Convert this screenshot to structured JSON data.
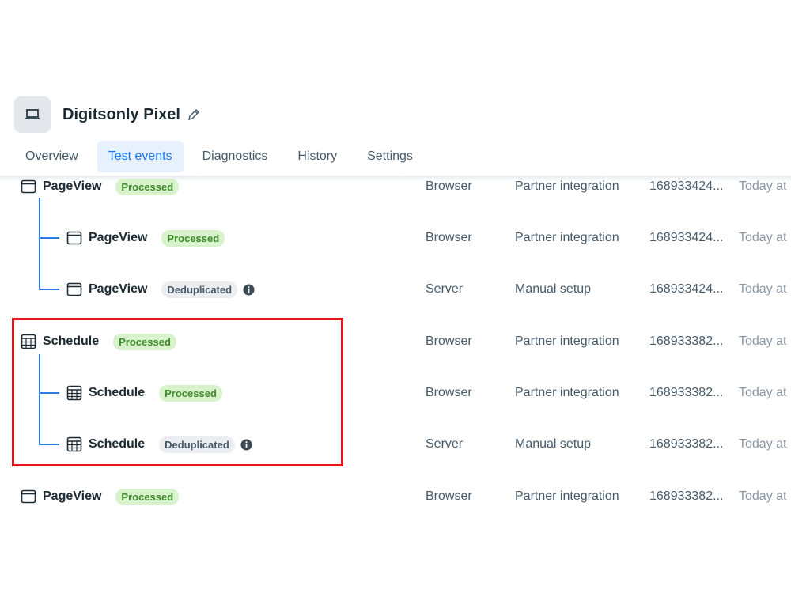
{
  "header": {
    "title": "Digitsonly Pixel",
    "icon": "laptop-icon",
    "edit_icon": "pencil-icon"
  },
  "tabs": [
    {
      "label": "Overview",
      "active": false
    },
    {
      "label": "Test events",
      "active": true
    },
    {
      "label": "Diagnostics",
      "active": false
    },
    {
      "label": "History",
      "active": false
    },
    {
      "label": "Settings",
      "active": false
    }
  ],
  "colors": {
    "accent": "#1877f2",
    "processed_bg": "#d8f2cc",
    "processed_text": "#3f8a2c",
    "highlight": "#e8141b",
    "tree_line": "#2d7be5"
  },
  "events": [
    {
      "name": "PageView",
      "icon": "page-icon",
      "badge": "Processed",
      "badge_type": "processed",
      "source": "Browser",
      "method": "Partner integration",
      "id": "168933424...",
      "time": "Today at"
    },
    {
      "name": "PageView",
      "icon": "page-icon",
      "badge": "Processed",
      "badge_type": "processed",
      "source": "Browser",
      "method": "Partner integration",
      "id": "168933424...",
      "time": "Today at"
    },
    {
      "name": "PageView",
      "icon": "page-icon",
      "badge": "Deduplicated",
      "badge_type": "deduplicated",
      "info_icon": "info-icon",
      "source": "Server",
      "method": "Manual setup",
      "id": "168933424...",
      "time": "Today at"
    },
    {
      "name": "Schedule",
      "icon": "calendar-grid-icon",
      "badge": "Processed",
      "badge_type": "processed",
      "source": "Browser",
      "method": "Partner integration",
      "id": "168933382...",
      "time": "Today at"
    },
    {
      "name": "Schedule",
      "icon": "calendar-grid-icon",
      "badge": "Processed",
      "badge_type": "processed",
      "source": "Browser",
      "method": "Partner integration",
      "id": "168933382...",
      "time": "Today at"
    },
    {
      "name": "Schedule",
      "icon": "calendar-grid-icon",
      "badge": "Deduplicated",
      "badge_type": "deduplicated",
      "info_icon": "info-icon",
      "source": "Server",
      "method": "Manual setup",
      "id": "168933382...",
      "time": "Today at"
    },
    {
      "name": "PageView",
      "icon": "page-icon",
      "badge": "Processed",
      "badge_type": "processed",
      "source": "Browser",
      "method": "Partner integration",
      "id": "168933382...",
      "time": "Today at"
    }
  ]
}
